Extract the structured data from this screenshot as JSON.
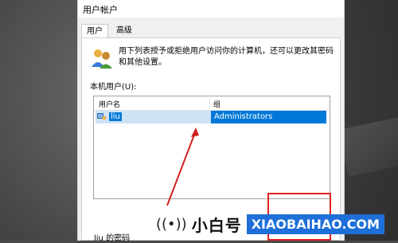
{
  "window": {
    "title": "用户帐户"
  },
  "tabs": [
    {
      "label": "用户",
      "active": true
    },
    {
      "label": "高级",
      "active": false
    }
  ],
  "main": {
    "description": "用下列表授予或拒绝用户访问你的计算机，还可以更改其密码和其他设置。",
    "section_label": "本机用户(U):",
    "users_icon": "users-icon"
  },
  "user_list": {
    "columns": [
      "用户名",
      "组"
    ],
    "rows": [
      {
        "name": "liu",
        "group": "Administrators",
        "selected": true
      }
    ]
  },
  "footer": {
    "password_label": "liu 的密码"
  },
  "watermark": {
    "brand_cn": "小白号",
    "brand_url": "XIAOBAIHAO.COM"
  },
  "colors": {
    "selection": "#0078d7",
    "highlight_box": "#e02020",
    "brand_blue": "#1e6fd9"
  }
}
